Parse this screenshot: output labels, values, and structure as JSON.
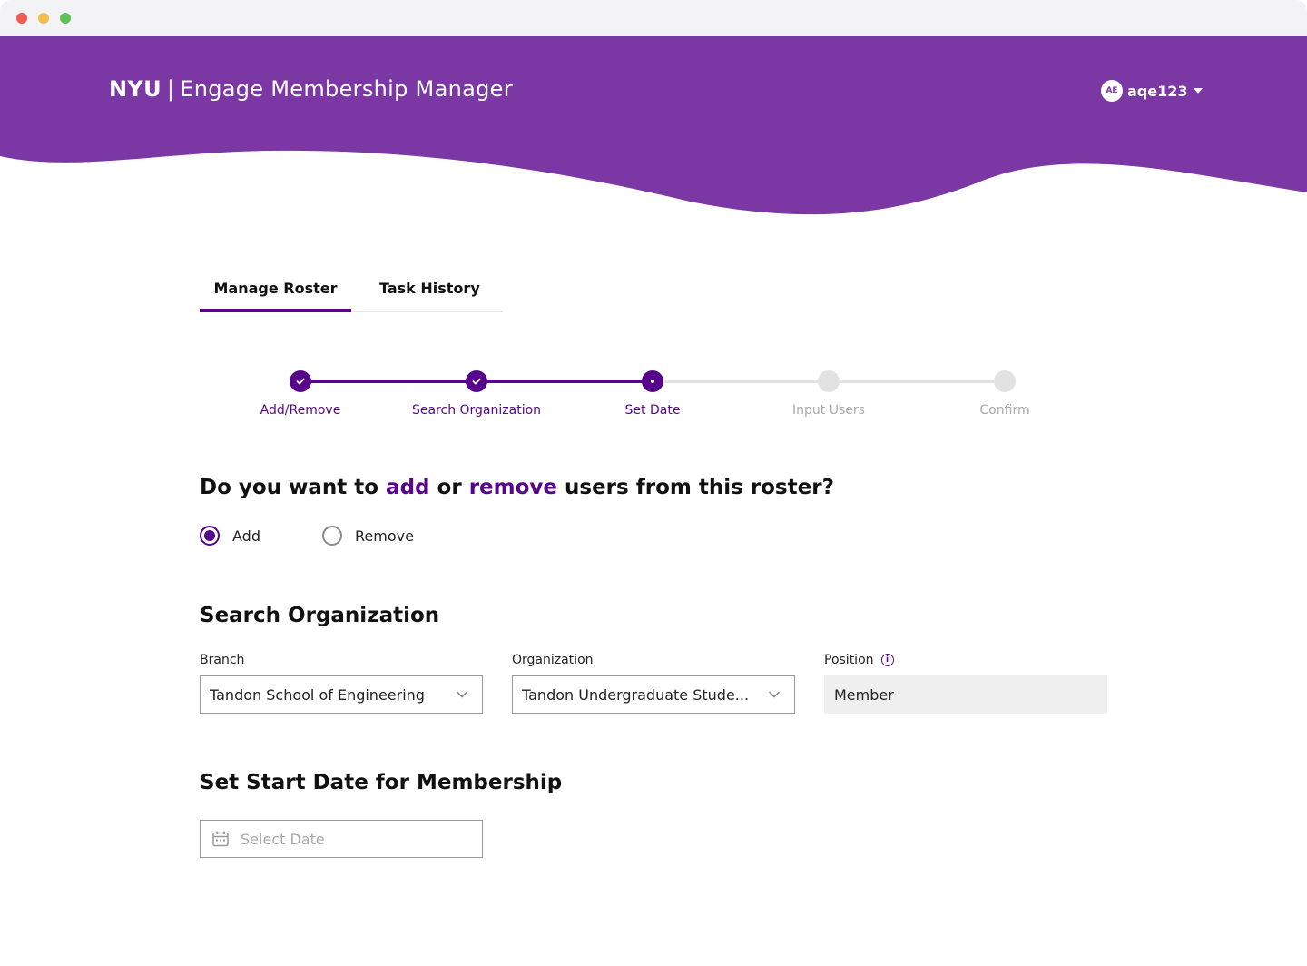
{
  "header": {
    "brand_short": "NYU",
    "separator": "|",
    "app_name": "Engage Membership Manager",
    "background_color": "#7b37a4",
    "user": {
      "initials": "AE",
      "username": "aqe123",
      "menu_icon": "caret-down-icon"
    }
  },
  "tabs": [
    {
      "label": "Manage Roster",
      "active": true
    },
    {
      "label": "Task History",
      "active": false
    }
  ],
  "stepper": {
    "steps": [
      {
        "label": "Add/Remove",
        "state": "done"
      },
      {
        "label": "Search Organization",
        "state": "done"
      },
      {
        "label": "Set Date",
        "state": "current"
      },
      {
        "label": "Input Users",
        "state": "todo"
      },
      {
        "label": "Confirm",
        "state": "todo"
      }
    ],
    "accent_color": "#57068c"
  },
  "question": {
    "prefix": "Do you want to",
    "add_word": "add",
    "or_word": "or",
    "remove_word": "remove",
    "suffix": "users from this roster?",
    "options": [
      {
        "label": "Add",
        "checked": true
      },
      {
        "label": "Remove",
        "checked": false
      }
    ]
  },
  "search_org": {
    "title": "Search Organization",
    "branch": {
      "label": "Branch",
      "value": "Tandon School of Engineering"
    },
    "organization": {
      "label": "Organization",
      "value": "Tandon Undergraduate Stude..."
    },
    "position": {
      "label": "Position",
      "value": "Member",
      "info_icon": "info-icon"
    }
  },
  "start_date": {
    "title": "Set Start Date for Membership",
    "placeholder": "Select Date",
    "icon": "calendar-icon"
  }
}
